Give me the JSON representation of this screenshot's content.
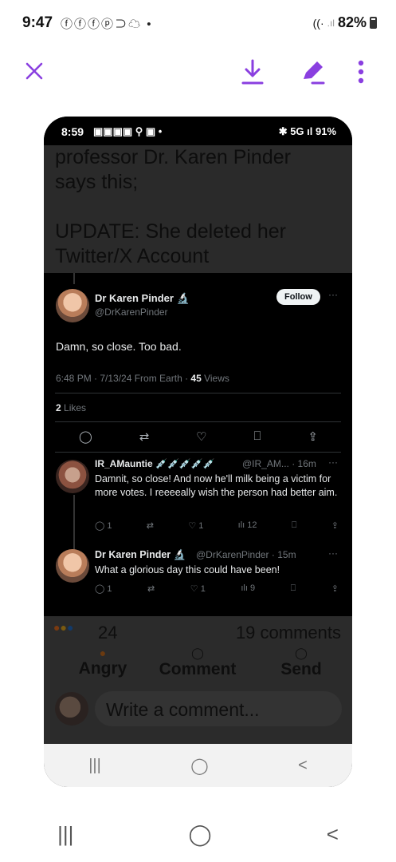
{
  "status_bar": {
    "time": "9:47",
    "notif_icons": [
      "facebook-icon",
      "facebook-icon",
      "facebook-icon",
      "pinterest-icon",
      "link-icon",
      "cloud-icon"
    ],
    "dot": "•",
    "battery": "82%"
  },
  "toolbar": {
    "close_icon": "✕",
    "download_icon": "⤓",
    "edit_icon": "✎",
    "more_icon": "⋮"
  },
  "screenshot": {
    "inner_status": {
      "time": "8:59",
      "icons": "▣▣▣▣ ⚲ ▣ •",
      "right": "✱ 5G ıl 91%"
    },
    "post_text": {
      "line1": "professor Dr. Karen Pinder",
      "line2": "says this;",
      "line3": "UPDATE: She deleted her",
      "line4": "Twitter/X Account"
    },
    "tweet": {
      "name": "Dr Karen Pinder 🔬",
      "handle": "@DrKarenPinder",
      "follow_label": "Follow",
      "more": "···",
      "body": "Damn, so close. Too bad.",
      "meta_time": "6:48 PM · 7/13/24 From Earth · ",
      "views_count": "45",
      "views_label": " Views",
      "likes_count": "2",
      "likes_label": " Likes"
    },
    "replies": [
      {
        "name": "IR_AMauntie 💉💉💉💉💉",
        "meta": "@IR_AM... · 16m",
        "more": "···",
        "text": "Damnit, so close! And now he'll milk being a victim for more votes. I reeeeally wish the person had better aim.",
        "reply_count": "1",
        "like_count": "1",
        "views": "12"
      },
      {
        "name": "Dr Karen Pinder 🔬",
        "meta": "@DrKarenPinder · 15m",
        "more": "···",
        "text": "What a glorious day this could have been!",
        "reply_count": "1",
        "like_count": "1",
        "views": "9"
      }
    ],
    "fb_footer": {
      "reaction_count": "24",
      "comments": "19 comments",
      "angry_label": "Angry",
      "comment_label": "Comment",
      "send_label": "Send",
      "write_placeholder": "Write a comment..."
    },
    "inner_nav": {
      "recent": "|||",
      "home": "◯",
      "back": "<"
    }
  },
  "bottom_nav": {
    "recent": "|||",
    "home": "◯",
    "back": "<"
  },
  "colors": {
    "accent": "#8a3fe0",
    "tweet_bg": "#000000",
    "fb_bg": "#2b2b2b"
  }
}
